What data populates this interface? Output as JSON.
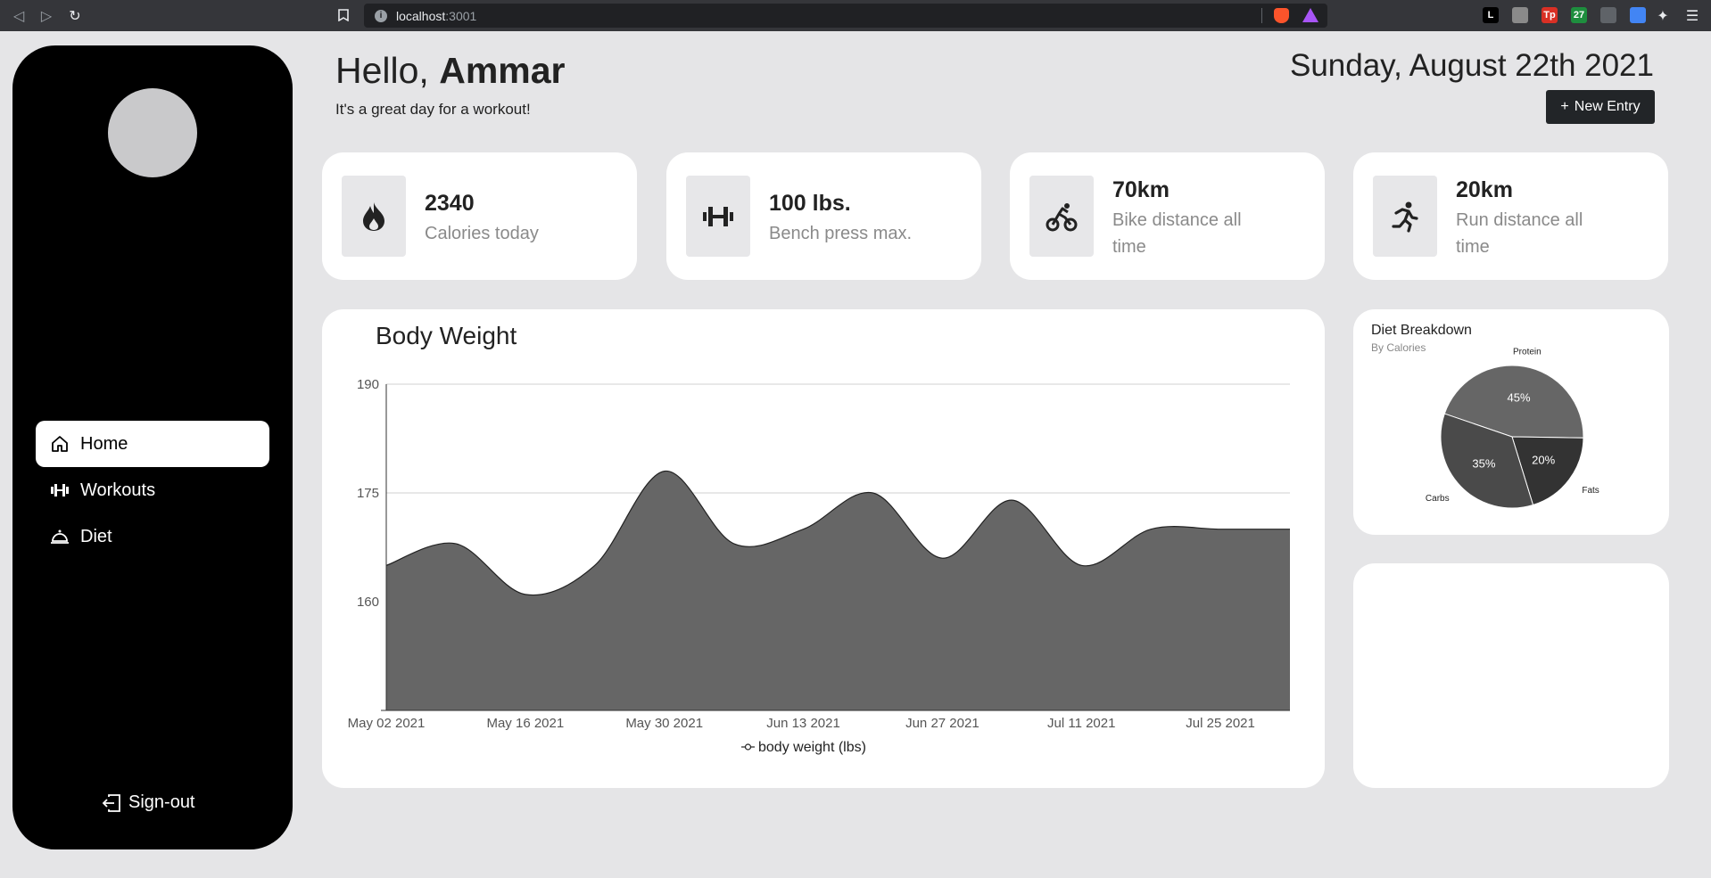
{
  "browser": {
    "url_host": "localhost",
    "url_port": ":3001",
    "extensions": [
      {
        "label": "L",
        "color": "#000000"
      },
      {
        "label": "",
        "color": "#8a8a8a"
      },
      {
        "label": "Tp",
        "color": "#d93025"
      },
      {
        "label": "27",
        "color": "#1e8e3e"
      },
      {
        "label": "",
        "color": "#5f6368"
      },
      {
        "label": "",
        "color": "#4285f4"
      }
    ]
  },
  "sidebar": {
    "items": [
      {
        "label": "Home",
        "icon": "home-icon",
        "active": true
      },
      {
        "label": "Workouts",
        "icon": "dumbbell-icon",
        "active": false
      },
      {
        "label": "Diet",
        "icon": "cloche-icon",
        "active": false
      }
    ],
    "signout_label": "Sign-out"
  },
  "header": {
    "greeting_prefix": "Hello,",
    "name": "Ammar",
    "subtitle": "It's a great day for a workout!",
    "date": "Sunday, August 22th 2021",
    "new_entry_label": "New Entry"
  },
  "stats": [
    {
      "value": "2340",
      "label": "Calories today",
      "icon": "flame-icon"
    },
    {
      "value": "100 lbs.",
      "label": "Bench press max.",
      "icon": "dumbbell-icon"
    },
    {
      "value": "70km",
      "label": "Bike distance all time",
      "icon": "bike-icon"
    },
    {
      "value": "20km",
      "label": "Run distance all time",
      "icon": "runner-icon"
    }
  ],
  "chart_data": [
    {
      "type": "area",
      "title": "Body Weight",
      "x": [
        "May 02 2021",
        "May 09 2021",
        "May 16 2021",
        "May 23 2021",
        "May 30 2021",
        "Jun 06 2021",
        "Jun 13 2021",
        "Jun 20 2021",
        "Jun 27 2021",
        "Jul 04 2021",
        "Jul 11 2021",
        "Jul 18 2021",
        "Jul 25 2021",
        "Aug 01 2021"
      ],
      "x_tick_labels": [
        "May 02 2021",
        "May 16 2021",
        "May 30 2021",
        "Jun 13 2021",
        "Jun 27 2021",
        "Jul 11 2021",
        "Jul 25 2021"
      ],
      "series": [
        {
          "name": "body weight (lbs)",
          "values": [
            165,
            168,
            161,
            165,
            178,
            168,
            170,
            175,
            166,
            174,
            165,
            170,
            170,
            170
          ],
          "color": "#666666"
        }
      ],
      "ylim": [
        145,
        190
      ],
      "y_ticks": [
        160,
        175,
        190
      ],
      "grid": true,
      "legend": "bottom"
    },
    {
      "type": "pie",
      "title": "Diet Breakdown",
      "subtitle": "By Calories",
      "categories": [
        "Protein",
        "Fats",
        "Carbs"
      ],
      "values": [
        45,
        20,
        35
      ],
      "labels": [
        "45%",
        "20%",
        "35%"
      ],
      "colors": [
        "#666666",
        "#333333",
        "#4a4a4a"
      ]
    }
  ]
}
